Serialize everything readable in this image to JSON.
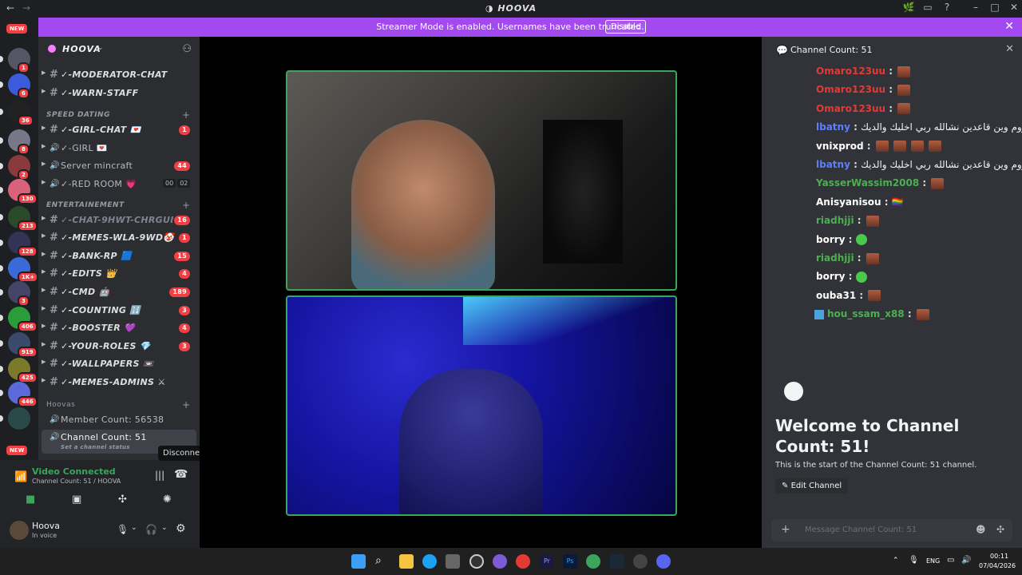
{
  "window": {
    "title": "HOOVA",
    "back": "←",
    "forward": "→"
  },
  "banner": {
    "text": "Streamer Mode is enabled. Usernames have been truncated.",
    "button": "Disable",
    "close": "✕"
  },
  "servers": {
    "new_top": "NEW",
    "new_bottom": "NEW",
    "badges": [
      "1",
      "6",
      "36",
      "8",
      "2",
      "130",
      "213",
      "128",
      "1K+",
      "3",
      "406",
      "919",
      "425",
      "446"
    ]
  },
  "server": {
    "name": "HOOVA"
  },
  "channels": [
    {
      "type": "text",
      "name": "✓-MODERATOR-CHAT",
      "badge": ""
    },
    {
      "type": "text",
      "name": "✓-WARN-STAFF",
      "badge": ""
    }
  ],
  "cat_speed": "SPEED DATING",
  "speed_channels": [
    {
      "type": "text",
      "name": "✓-GIRL-CHAT 💌",
      "badge": "1"
    },
    {
      "type": "voice",
      "name": "✓-GIRL 💌",
      "badge": ""
    },
    {
      "type": "voice",
      "name": "Server mincraft",
      "badge": "44"
    },
    {
      "type": "voice",
      "name": "✓-RED ROOM 💗",
      "badge": ""
    }
  ],
  "red_room_counts": [
    "00",
    "02"
  ],
  "cat_ent": "ENTERTAINEMENT",
  "ent_channels": [
    {
      "name": "✓-CHAT-9HWT-CHRGUI",
      "badge": "16",
      "dim": true
    },
    {
      "name": "✓-MEMES-WLA-9WD🤡",
      "badge": "1"
    },
    {
      "name": "✓-BANK-RP 🟦",
      "badge": "15"
    },
    {
      "name": "✓-EDITS 👑",
      "badge": "4"
    },
    {
      "name": "✓-CMD 🤖",
      "badge": "189"
    },
    {
      "name": "✓-COUNTING 🔢",
      "badge": "3"
    },
    {
      "name": "✓-BOOSTER 💜",
      "badge": "4"
    },
    {
      "name": "✓-YOUR-ROLES 💎",
      "badge": "3"
    },
    {
      "name": "✓-WALLPAPERS 📼",
      "badge": ""
    },
    {
      "name": "✓-MEMES-ADMINS ⚔",
      "badge": ""
    }
  ],
  "cat_hoovas": "Hoovas",
  "member_count": "Member Count: 56538",
  "channel_count": "Channel Count: 51",
  "channel_status": "Set a channel status",
  "tooltip": "Disconnect",
  "voice": {
    "status": "Video Connected",
    "sub": "Channel Count: 51 / HOOVA"
  },
  "user": {
    "name": "Hoova",
    "status": "In voice"
  },
  "chat": {
    "header": "Channel Count: 51",
    "messages": [
      {
        "user": "Omaro123uu",
        "text": "",
        "color": "#e53935",
        "emotes": 1
      },
      {
        "user": "Omaro123uu",
        "text": "",
        "color": "#e53935",
        "emotes": 1
      },
      {
        "user": "Omaro123uu",
        "text": "",
        "color": "#e53935",
        "emotes": 1
      },
      {
        "user": "lbatny",
        "text": "اجبدني لروم وين قاعدين نشالله ربي اخليك والديك",
        "color": "#5b7fff",
        "emotes": 0
      },
      {
        "user": "vnixprod",
        "text": "",
        "color": "#ffffff",
        "emotes": 4
      },
      {
        "user": "lbatny",
        "text": "اجبدني لروم وين قاعدين نشالله ربي اخليك والديك",
        "color": "#5b7fff",
        "emotes": 0
      },
      {
        "user": "YasserWassim2008",
        "text": "",
        "color": "#4caf50",
        "emotes": 1
      },
      {
        "user": "Anisyanisou",
        "text": "🏳️‍🌈",
        "color": "#ffffff",
        "emotes": 0
      },
      {
        "user": "riadhjji",
        "text": "",
        "color": "#4caf50",
        "emotes": 1
      },
      {
        "user": "borry",
        "text": "",
        "color": "#ffffff",
        "emotes": 0,
        "green": true
      },
      {
        "user": "riadhjji",
        "text": "",
        "color": "#4caf50",
        "emotes": 1
      },
      {
        "user": "borry",
        "text": "",
        "color": "#ffffff",
        "emotes": 0,
        "green": true
      },
      {
        "user": "ouba31",
        "text": "",
        "color": "#ffffff",
        "emotes": 1
      },
      {
        "user": "hou_ssam_x88",
        "text": "",
        "color": "#4caf50",
        "emotes": 1
      }
    ],
    "welcome_title": "Welcome to Channel Count: 51!",
    "welcome_sub": "This is the start of the Channel Count: 51 channel.",
    "edit_button": "Edit Channel",
    "input_placeholder": "Message Channel Count: 51"
  },
  "taskbar": {
    "lang": "ENG",
    "time": "00:11",
    "date": "07/04/2026"
  }
}
